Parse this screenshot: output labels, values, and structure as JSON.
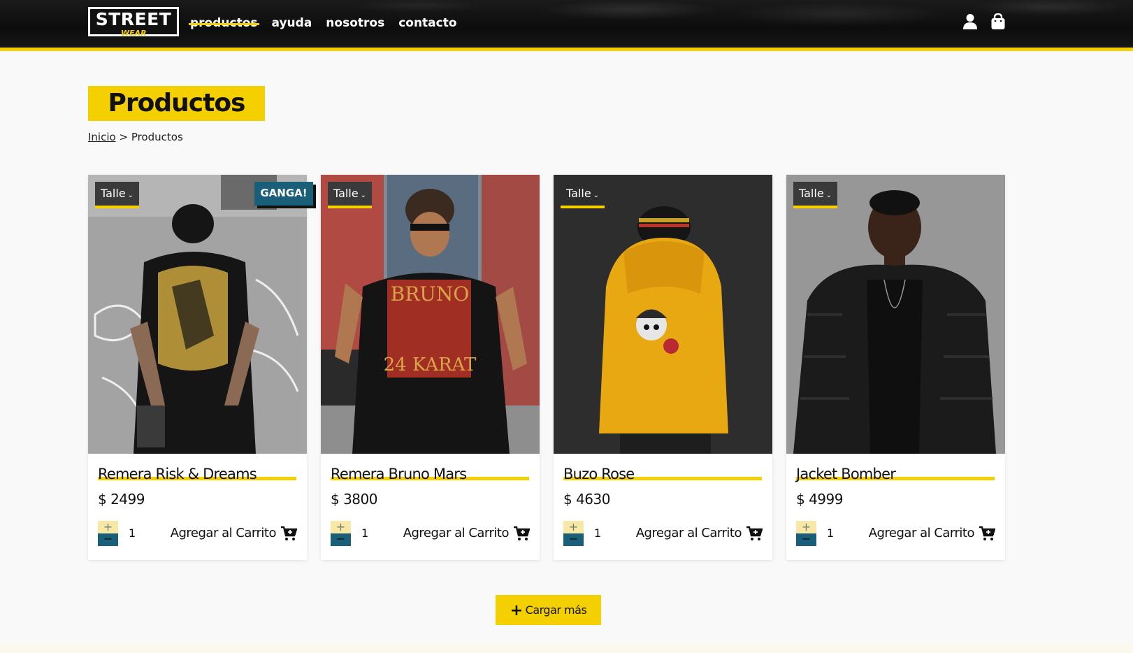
{
  "header": {
    "logo_main": "STREET",
    "logo_sub": "WEAR",
    "nav": [
      "productos",
      "ayuda",
      "nosotros",
      "contacto"
    ],
    "active_nav": "productos",
    "icons": [
      "user-icon",
      "shopping-bag-icon"
    ]
  },
  "page": {
    "title": "Productos",
    "breadcrumb": {
      "home": "Inicio",
      "separator": " > ",
      "current": "Productos"
    }
  },
  "products": [
    {
      "name": "Remera Risk & Dreams",
      "price": "$ 2499",
      "size_label": "Talle",
      "badge": "GANGA!",
      "qty": "1",
      "add_label": "Agregar al Carrito"
    },
    {
      "name": "Remera Bruno Mars",
      "price": "$ 3800",
      "size_label": "Talle",
      "badge": "",
      "qty": "1",
      "add_label": "Agregar al Carrito"
    },
    {
      "name": "Buzo Rose",
      "price": "$ 4630",
      "size_label": "Talle",
      "badge": "",
      "qty": "1",
      "add_label": "Agregar al Carrito"
    },
    {
      "name": "Jacket Bomber",
      "price": "$ 4999",
      "size_label": "Talle",
      "badge": "",
      "qty": "1",
      "add_label": "Agregar al Carrito"
    }
  ],
  "qty_controls": {
    "plus": "+",
    "minus": "−"
  },
  "load_more": {
    "label": "Cargar más"
  },
  "colors": {
    "accent": "#f5d000",
    "secondary": "#1a5f7a",
    "header_bg": "#111111",
    "page_bg": "#f9f9f9"
  }
}
